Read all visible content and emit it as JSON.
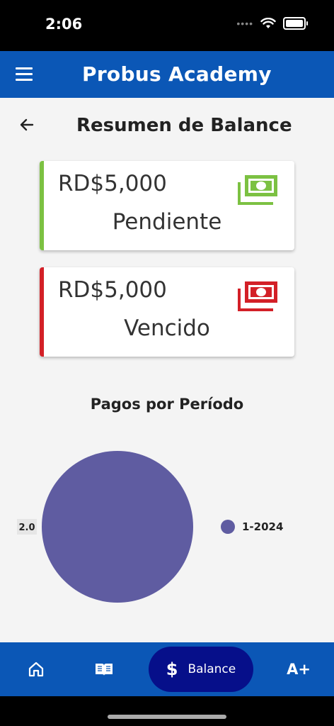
{
  "status_bar": {
    "time": "2:06",
    "signal": "••••"
  },
  "app_bar": {
    "title": "Probus Academy"
  },
  "page": {
    "title": "Resumen de Balance"
  },
  "cards": [
    {
      "amount": "RD$5,000",
      "label": "Pendiente",
      "accent_color": "#7cc142",
      "icon": "money-icon"
    },
    {
      "amount": "RD$5,000",
      "label": "Vencido",
      "accent_color": "#d32027",
      "icon": "money-icon"
    }
  ],
  "chart": {
    "title": "Pagos por Período"
  },
  "chart_data": {
    "type": "pie",
    "title": "Pagos por Período",
    "series": [
      {
        "name": "1-2024",
        "value": 2.0,
        "label": "2.0",
        "color": "#5f5ca1"
      }
    ],
    "legend_position": "right"
  },
  "bottom_nav": {
    "items": [
      {
        "icon": "home-icon"
      },
      {
        "icon": "book-icon"
      },
      {
        "icon": "dollar-icon",
        "label": "Balance",
        "symbol": "$",
        "active": true
      },
      {
        "icon": "font-size-icon",
        "label": "A+"
      }
    ]
  },
  "colors": {
    "primary": "#0b57b6",
    "active_nav": "#060f8a",
    "background": "#f4f4f4"
  }
}
